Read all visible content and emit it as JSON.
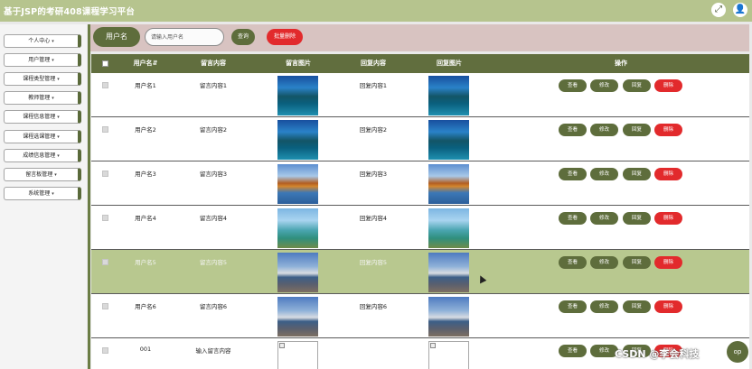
{
  "app": {
    "title": "基于JSP的考研408课程学习平台"
  },
  "header_icons": {
    "fullscreen": "fullscreen-icon",
    "user": "user-icon"
  },
  "sidebar": {
    "items": [
      {
        "label": "个人中心"
      },
      {
        "label": "用户管理"
      },
      {
        "label": "课程类型管理"
      },
      {
        "label": "教师管理"
      },
      {
        "label": "课程信息管理"
      },
      {
        "label": "课程选课管理"
      },
      {
        "label": "成绩信息管理"
      },
      {
        "label": "留言板管理"
      },
      {
        "label": "系统管理"
      }
    ],
    "caret": "▾"
  },
  "search": {
    "field_label": "用户名",
    "placeholder": "请输入用户名",
    "query_label": "查询",
    "batch_delete_label": "批量删除"
  },
  "table": {
    "headers": [
      "用户名",
      "留言内容",
      "留言图片",
      "回复内容",
      "回复图片",
      "操作"
    ],
    "sort_mark": "⇵",
    "actions": {
      "view": "查看",
      "edit": "修改",
      "reply": "回复",
      "delete": "删除"
    },
    "rows": [
      {
        "username": "用户名1",
        "message": "留言内容1",
        "reply": "回复内容1",
        "image": "lake"
      },
      {
        "username": "用户名2",
        "message": "留言内容2",
        "reply": "回复内容2",
        "image": "lake"
      },
      {
        "username": "用户名3",
        "message": "留言内容3",
        "reply": "回复内容3",
        "image": "autumn"
      },
      {
        "username": "用户名4",
        "message": "留言内容4",
        "reply": "回复内容4",
        "image": "hut"
      },
      {
        "username": "用户名5",
        "message": "留言内容5",
        "reply": "回复内容5",
        "image": "pier",
        "highlighted": true
      },
      {
        "username": "用户名6",
        "message": "留言内容6",
        "reply": "回复内容6",
        "image": "pier"
      },
      {
        "username": "001",
        "message": "输入留言内容",
        "reply": "",
        "image": "broken"
      }
    ]
  },
  "watermark": "CSDN @李会科技",
  "fab_label": "op",
  "colors": {
    "topbar": "#b6c48e",
    "accent": "#5e6d3c",
    "danger": "#e22a2c",
    "highlight_row": "#b8c88f"
  }
}
